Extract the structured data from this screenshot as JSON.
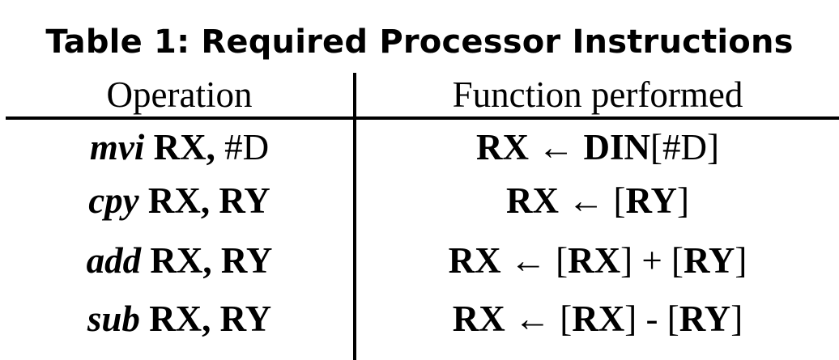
{
  "title": "Table 1: Required Processor Instructions",
  "headers": {
    "operation": "Operation",
    "function": "Function performed"
  },
  "rows": [
    {
      "op": {
        "mnemonic": "mvi",
        "operands": [
          {
            "text": "RX,",
            "bold": true
          },
          {
            "text": "#D",
            "bold": false
          }
        ]
      },
      "fn": [
        {
          "text": "RX ← ",
          "bold": true
        },
        {
          "text": "DIN",
          "bold": true
        },
        {
          "text": "[#D]",
          "bold": false
        }
      ]
    },
    {
      "op": {
        "mnemonic": "cpy",
        "operands": [
          {
            "text": "RX, RY",
            "bold": true
          }
        ]
      },
      "fn": [
        {
          "text": "RX ← ",
          "bold": true
        },
        {
          "text": "[",
          "bold": false
        },
        {
          "text": "RY",
          "bold": true
        },
        {
          "text": "]",
          "bold": false
        }
      ]
    },
    {
      "op": {
        "mnemonic": "add",
        "operands": [
          {
            "text": "RX, RY",
            "bold": true
          }
        ]
      },
      "fn": [
        {
          "text": "RX ← ",
          "bold": true
        },
        {
          "text": "[",
          "bold": false
        },
        {
          "text": "RX",
          "bold": true
        },
        {
          "text": "] + [",
          "bold": false
        },
        {
          "text": "RY",
          "bold": true
        },
        {
          "text": "]",
          "bold": false
        }
      ]
    },
    {
      "op": {
        "mnemonic": "sub",
        "operands": [
          {
            "text": "RX, RY",
            "bold": true
          }
        ]
      },
      "fn": [
        {
          "text": "RX ← ",
          "bold": true
        },
        {
          "text": "[",
          "bold": false
        },
        {
          "text": "RX",
          "bold": true
        },
        {
          "text": "] - [",
          "bold": false
        },
        {
          "text": "RY",
          "bold": true
        },
        {
          "text": "]",
          "bold": false
        }
      ]
    }
  ]
}
